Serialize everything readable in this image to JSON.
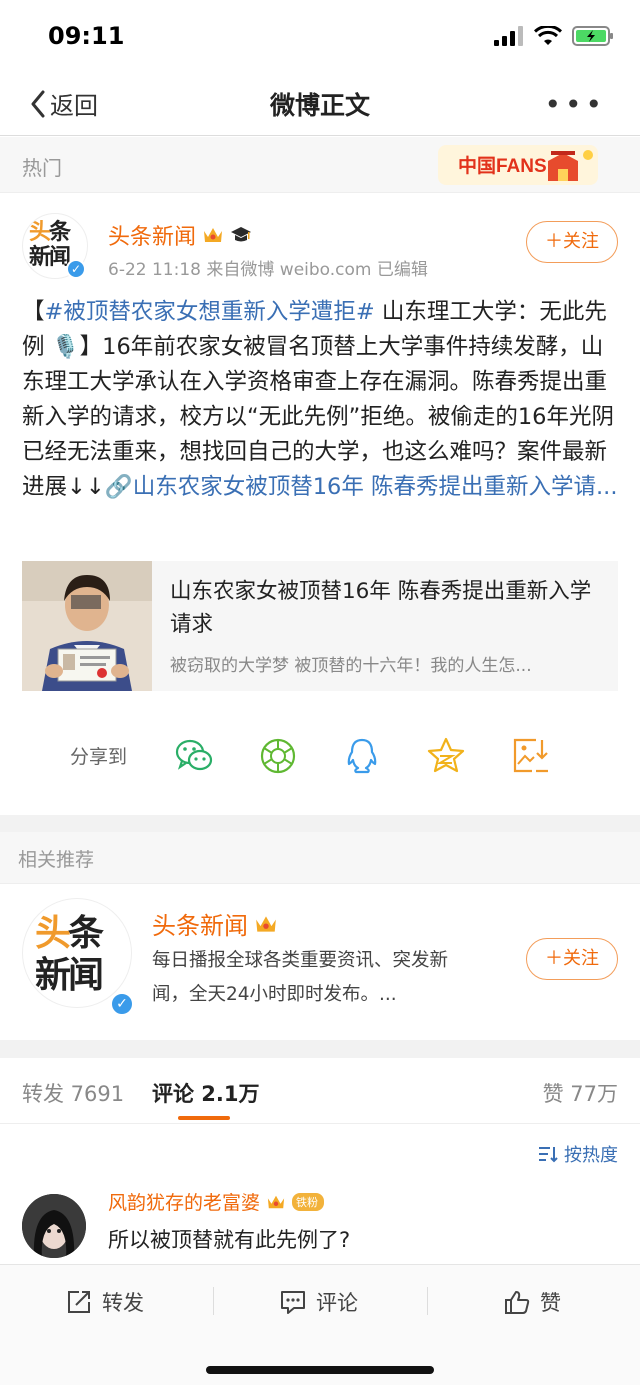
{
  "status": {
    "time": "09:11"
  },
  "nav": {
    "back_label": "返回",
    "title": "微博正文"
  },
  "hot": {
    "label": "热门",
    "badge_text": "中国FANS"
  },
  "post": {
    "author": "头条新闻",
    "avatar_line1_a": "头",
    "avatar_line1_b": "条",
    "avatar_line2": "新闻",
    "meta": "6-22 11:18  来自微博 weibo.com  已编辑",
    "follow_label": "＋关注",
    "body_open": "【",
    "hashtag": "#被顶替农家女想重新入学遭拒#",
    "body_main": " 山东理工大学：无此先例 🎙️】16年前农家女被冒名顶替上大学事件持续发酵，山东理工大学承认在入学资格审查上存在漏洞。陈春秀提出重新入学的请求，校方以“无此先例”拒绝。被偷走的16年光阴已经无法重来，想找回自己的大学，也这么难吗？案件最新进展↓↓",
    "body_link": "🔗山东农家女被顶替16年 陈春秀提出重新入学请..."
  },
  "link_card": {
    "title": "山东农家女被顶替16年 陈春秀提出重新入学请求",
    "desc": "被窃取的大学梦 被顶替的十六年！我的人生怎..."
  },
  "share": {
    "label": "分享到",
    "targets": [
      "wechat-icon",
      "moments-icon",
      "qq-icon",
      "qzone-icon",
      "save-image-icon"
    ]
  },
  "related": {
    "header": "相关推荐",
    "name": "头条新闻",
    "desc": "每日播报全球各类重要资讯、突发新闻，全天24小时即时发布。...",
    "follow_label": "＋关注"
  },
  "tabs": {
    "repost": "转发 7691",
    "comments": "评论 2.1万",
    "likes": "赞 77万"
  },
  "sort_label": "按热度",
  "comment": {
    "user": "风韵犹存的老富婆",
    "badge": "铁粉",
    "text": "所以被顶替就有此先例了?"
  },
  "bottom": {
    "repost": "转发",
    "comment": "评论",
    "like": "赞"
  },
  "colors": {
    "accent": "#f06a0c",
    "link": "#3a6fb4",
    "verified": "#3a9bea"
  }
}
